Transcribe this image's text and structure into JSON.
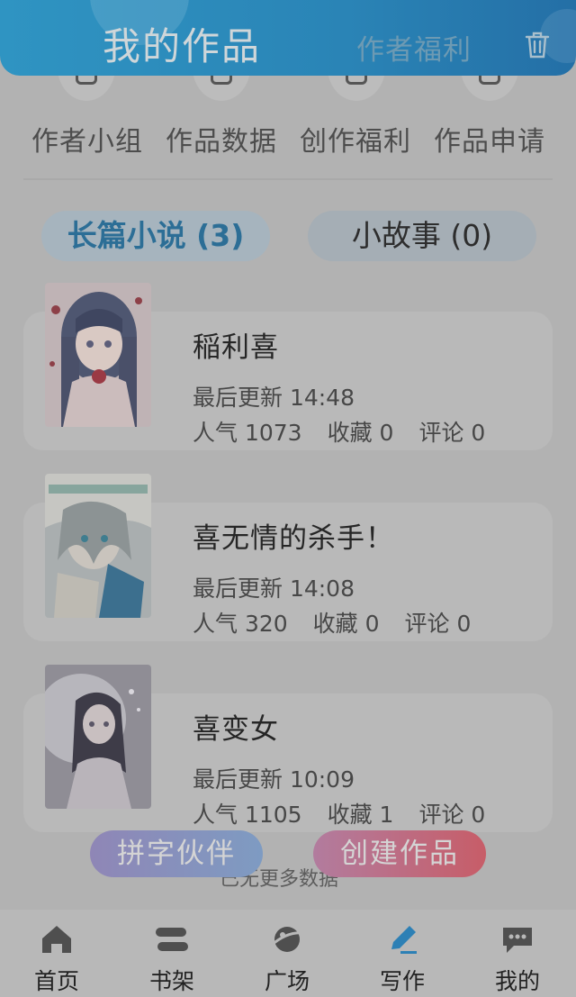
{
  "header": {
    "title": "我的作品",
    "link": "作者福利"
  },
  "quick_nav": [
    {
      "label": "作者小组",
      "icon": "group-icon"
    },
    {
      "label": "作品数据",
      "icon": "data-icon"
    },
    {
      "label": "创作福利",
      "icon": "gift-icon"
    },
    {
      "label": "作品申请",
      "icon": "application-icon"
    }
  ],
  "tabs": [
    {
      "label": "长篇小说 (3)",
      "active": true
    },
    {
      "label": "小故事 (0)",
      "active": false
    }
  ],
  "books": [
    {
      "title": "稲利喜",
      "updated": "最后更新 14:48",
      "popularity": "人气 1073",
      "favorites": "收藏 0",
      "comments": "评论 0"
    },
    {
      "title": "喜无情的杀手！",
      "updated": "最后更新 14:08",
      "popularity": "人气 320",
      "favorites": "收藏 0",
      "comments": "评论 0"
    },
    {
      "title": "喜变女",
      "updated": "最后更新 10:09",
      "popularity": "人气 1105",
      "favorites": "收藏 1",
      "comments": "评论 0"
    }
  ],
  "load_more": "已无更多数据",
  "buttons": {
    "partner": "拼字伙伴",
    "create": "创建作品"
  },
  "bottom_nav": [
    {
      "label": "首页",
      "icon": "home-icon"
    },
    {
      "label": "书架",
      "icon": "bookshelf-icon"
    },
    {
      "label": "广场",
      "icon": "planet-icon"
    },
    {
      "label": "写作",
      "icon": "pen-icon",
      "active": true
    },
    {
      "label": "我的",
      "icon": "chat-icon"
    }
  ],
  "colors": {
    "header": "#2a84b6",
    "active_tab_text": "#2c6e96",
    "active_nav": "#2d80b5",
    "create_button": "#c75d68",
    "partner_button": "#8f86b6"
  }
}
